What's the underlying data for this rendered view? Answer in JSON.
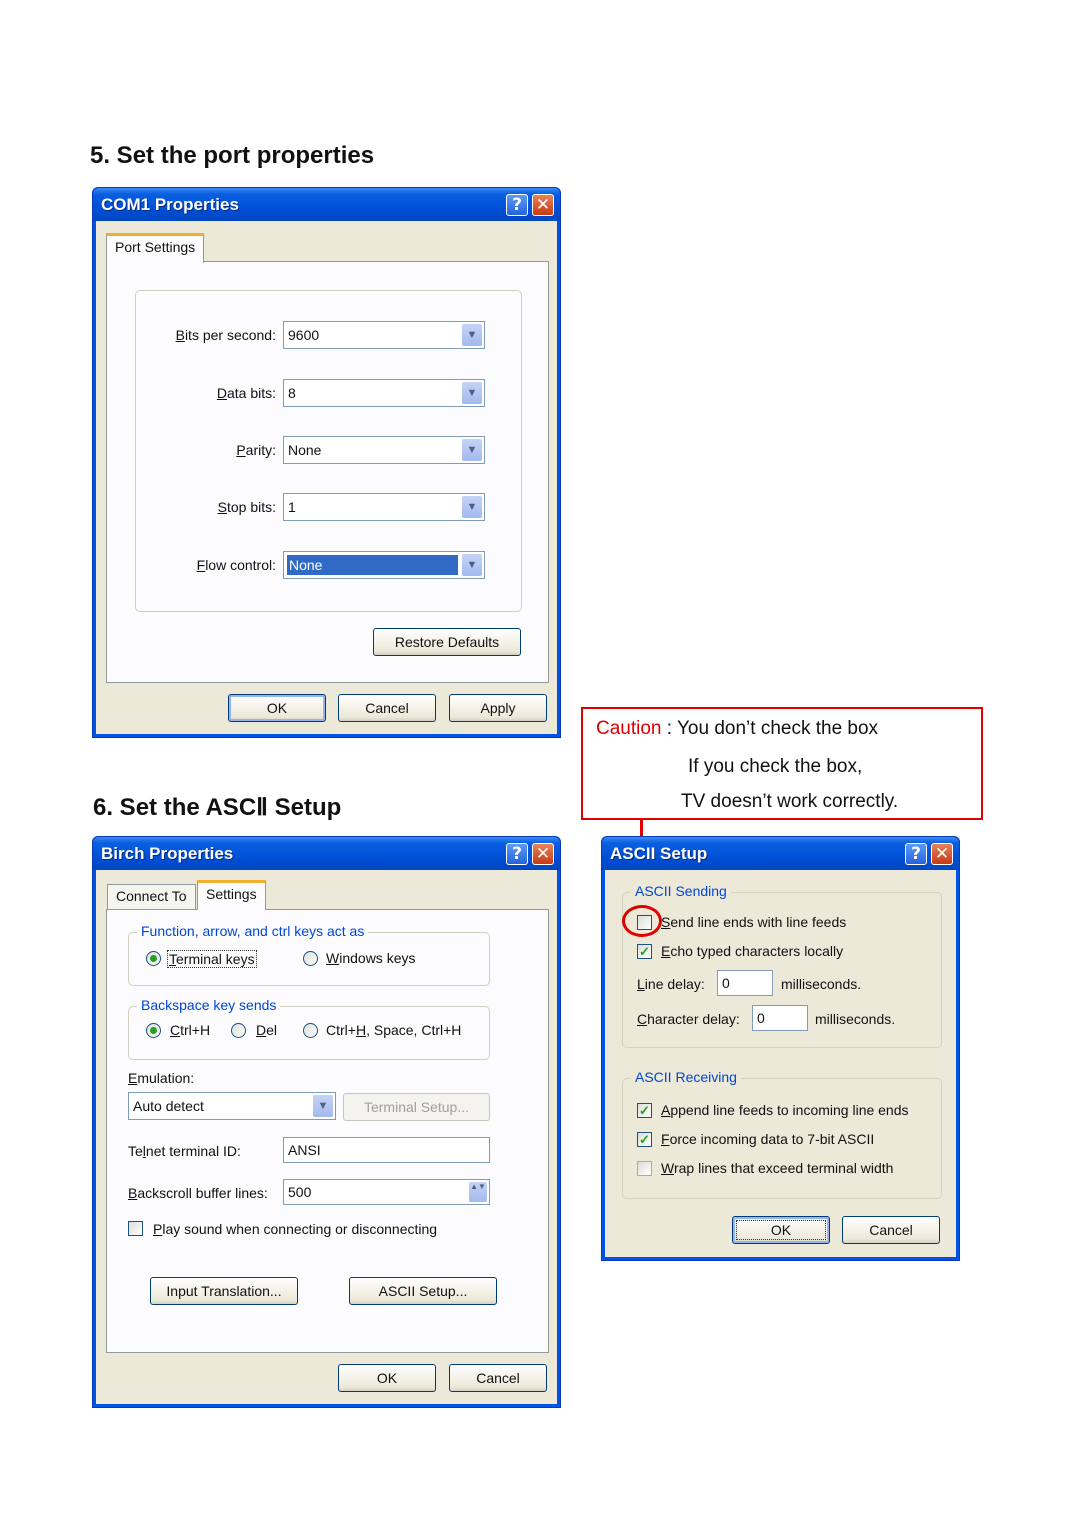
{
  "headings": {
    "step5": "5. Set the port properties",
    "step6": "6. Set the ASCⅡ Setup"
  },
  "icons": {
    "help": "?",
    "close": "✕",
    "combo_arrow": "▼",
    "spin": "▲▼",
    "check": "✓"
  },
  "com1": {
    "title": "COM1 Properties",
    "tab": "Port Settings",
    "fields": [
      {
        "label": "Bits per second:",
        "accel": "B",
        "value": "9600"
      },
      {
        "label": "Data bits:",
        "accel": "D",
        "value": "8"
      },
      {
        "label": "Parity:",
        "accel": "P",
        "value": "None"
      },
      {
        "label": "Stop bits:",
        "accel": "S",
        "value": "1"
      },
      {
        "label": "Flow control:",
        "accel": "F",
        "value": "None"
      }
    ],
    "restore_defaults": "Restore Defaults",
    "ok": "OK",
    "cancel": "Cancel",
    "apply": "Apply"
  },
  "birch": {
    "title": "Birch Properties",
    "tabs": [
      "Connect To",
      "Settings"
    ],
    "active_tab": "Settings",
    "keys_group": {
      "legend": "Function, arrow, and ctrl keys act as",
      "options": [
        "Terminal keys",
        "Windows keys"
      ],
      "selected": "Terminal keys"
    },
    "backspace_group": {
      "legend": "Backspace key sends",
      "options": [
        "Ctrl+H",
        "Del",
        "Ctrl+H, Space, Ctrl+H"
      ],
      "selected": "Ctrl+H"
    },
    "emulation_label": "Emulation:",
    "emulation_value": "Auto detect",
    "terminal_setup": "Terminal Setup...",
    "telnet_label": "Telnet terminal ID:",
    "telnet_value": "ANSI",
    "backscroll_label": "Backscroll buffer lines:",
    "backscroll_value": "500",
    "play_sound_label": "Play sound when connecting or disconnecting",
    "play_sound_checked": false,
    "input_translation": "Input Translation...",
    "ascii_setup": "ASCII Setup...",
    "ok": "OK",
    "cancel": "Cancel"
  },
  "ascii": {
    "title": "ASCII Setup",
    "sending_legend": "ASCII Sending",
    "send_line_ends": {
      "label": "Send line ends with line feeds",
      "checked": false
    },
    "echo_typed": {
      "label": "Echo typed characters locally",
      "checked": true
    },
    "line_delay_label": "Line delay:",
    "line_delay_value": "0",
    "char_delay_label": "Character delay:",
    "char_delay_value": "0",
    "ms_label": "milliseconds.",
    "receiving_legend": "ASCII Receiving",
    "append_lf": {
      "label": "Append line feeds to incoming line ends",
      "checked": true
    },
    "force_7bit": {
      "label": "Force incoming data to 7-bit ASCII",
      "checked": true
    },
    "wrap_lines": {
      "label": "Wrap lines that exceed terminal width",
      "checked": false
    },
    "ok": "OK",
    "cancel": "Cancel"
  },
  "caution": {
    "prefix": "Caution",
    "line1": " : You don’t check the box",
    "line2": "If you check the box,",
    "line3": "TV doesn’t work correctly.",
    "accent_color": "#e00000"
  }
}
